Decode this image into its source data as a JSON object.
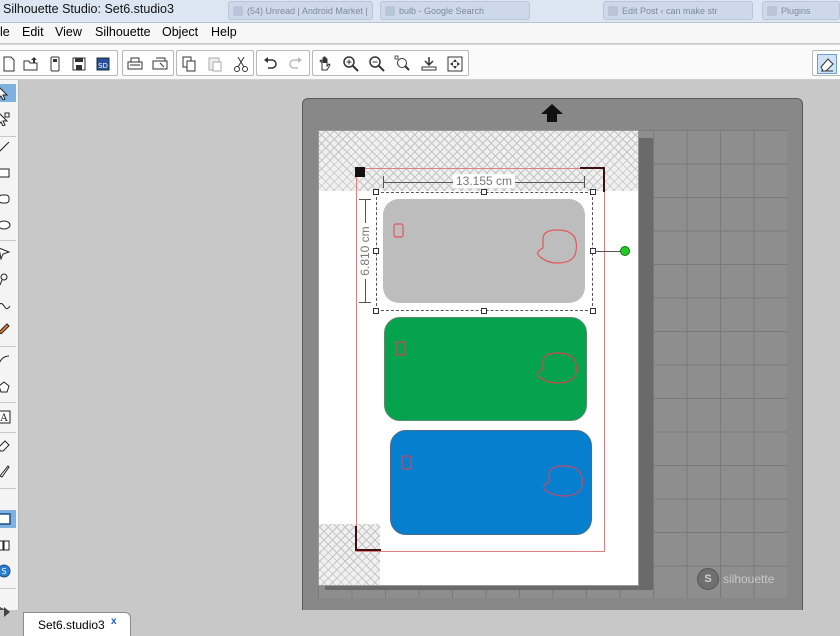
{
  "window": {
    "title": "Silhouette Studio: Set6.studio3",
    "background_tabs": [
      "",
      "(54) Unread | Android Market |",
      "bulb - Google Search",
      "Edit Post ‹ can make str",
      "Plugins"
    ]
  },
  "menubar": {
    "items": [
      "le",
      "Edit",
      "View",
      "Silhouette",
      "Object",
      "Help"
    ]
  },
  "toolbar": {
    "icons": [
      "new-doc-icon",
      "open-folder-icon",
      "save-to-card-icon",
      "save-icon",
      "save-as-icon",
      "print-icon",
      "print-cut-icon",
      "copy-icon",
      "paste-icon",
      "cut-icon",
      "undo-icon",
      "redo-icon",
      "pan-icon",
      "zoom-in-icon",
      "zoom-out-icon",
      "zoom-selection-icon",
      "zoom-page-icon",
      "fit-to-window-icon",
      "eraser-icon"
    ]
  },
  "canvas": {
    "dimension_width": "13.155 cm",
    "dimension_height": "6.810 cm",
    "cards": [
      {
        "name": "gray",
        "fill": "#bdbdbd",
        "outline": "#e05a5a"
      },
      {
        "name": "green",
        "fill": "#06a34f",
        "outline": "#d04848"
      },
      {
        "name": "blue",
        "fill": "#0680ce",
        "outline": "#c04a6a"
      }
    ],
    "mat_logo": "silhouette"
  },
  "tabs": {
    "document": "Set6.studio3",
    "close_glyph": "x"
  },
  "colors": {
    "accent": "#7fb1df",
    "rotation_handle": "#22cc22",
    "cut_border": "#e07f7f"
  }
}
